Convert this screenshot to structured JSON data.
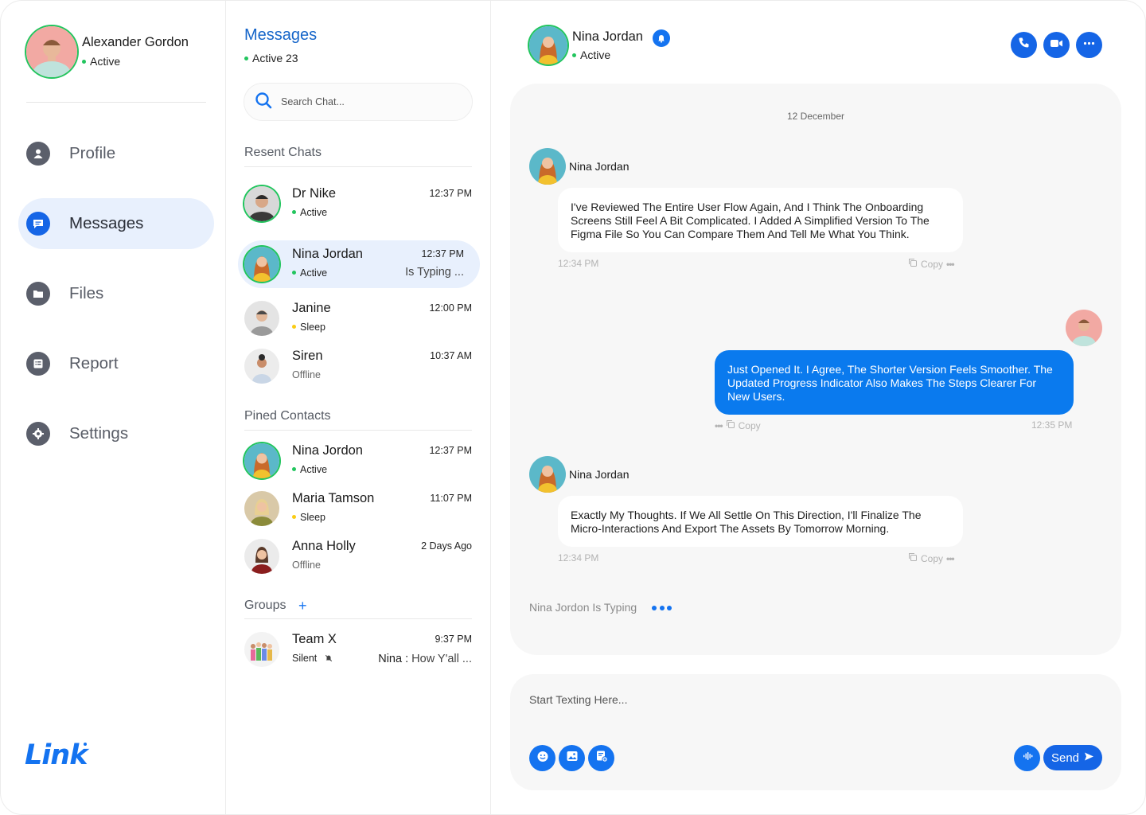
{
  "user": {
    "name": "Alexander Gordon",
    "status": "Active"
  },
  "nav": [
    {
      "label": "Profile",
      "icon": "user-icon",
      "active": false
    },
    {
      "label": "Messages",
      "icon": "chat-icon",
      "active": true
    },
    {
      "label": "Files",
      "icon": "folder-icon",
      "active": false
    },
    {
      "label": "Report",
      "icon": "report-icon",
      "active": false
    },
    {
      "label": "Settings",
      "icon": "gear-icon",
      "active": false
    }
  ],
  "logo": "Link",
  "messages_panel": {
    "title": "Messages",
    "active_count": "Active 23",
    "search_placeholder": "Search Chat...",
    "recent_title": "Resent Chats",
    "pinned_title": "Pined Contacts",
    "groups_title": "Groups",
    "groups_add": "+"
  },
  "recent_chats": [
    {
      "name": "Dr Nike",
      "status": "Active",
      "time": "12:37 PM"
    },
    {
      "name": "Nina Jordan",
      "status": "Active",
      "time": "12:37 PM",
      "note": "Is Typing ..."
    },
    {
      "name": "Janine",
      "status": "Sleep",
      "time": "12:00 PM"
    },
    {
      "name": "Siren",
      "status": "Offline",
      "time": "10:37 AM"
    }
  ],
  "pinned": [
    {
      "name": "Nina Jordon",
      "status": "Active",
      "time": "12:37 PM"
    },
    {
      "name": "Maria Tamson",
      "status": "Sleep",
      "time": "11:07 PM"
    },
    {
      "name": "Anna Holly",
      "status": "Offline",
      "time": "2 Days Ago"
    }
  ],
  "groups": [
    {
      "name": "Team X",
      "status": "Silent",
      "time": "9:37 PM",
      "last_sender": "Nina :",
      "last_text": "How Y'all ..."
    }
  ],
  "conversation": {
    "contact_name": "Nina Jordan",
    "contact_status": "Active",
    "date": "12 December",
    "messages": [
      {
        "from": "Nina Jordan",
        "text": "I've Reviewed The Entire User Flow Again, And I Think The Onboarding Screens Still Feel A Bit Complicated. I Added A Simplified Version To The Figma File So You Can Compare Them And Tell Me What You Think.",
        "time": "12:34 PM",
        "copy": "Copy"
      },
      {
        "from": "me",
        "text": "Just Opened It. I Agree, The Shorter Version Feels Smoother. The Updated Progress Indicator Also Makes The Steps Clearer For New Users.",
        "time": "12:35 PM",
        "copy": "Copy"
      },
      {
        "from": "Nina Jordan",
        "text": "Exactly My Thoughts. If We All Settle On This Direction, I'll Finalize The Micro-Interactions And Export The Assets By Tomorrow Morning.",
        "time": "12:34 PM",
        "copy": "Copy"
      }
    ],
    "typing": "Nina Jordon Is Typing"
  },
  "composer": {
    "placeholder": "Start Texting Here...",
    "send_label": "Send"
  },
  "colors": {
    "accent": "#1565e6",
    "bubble_out": "#0a7aee",
    "active": "#22c55e",
    "sleep": "#facc15"
  }
}
